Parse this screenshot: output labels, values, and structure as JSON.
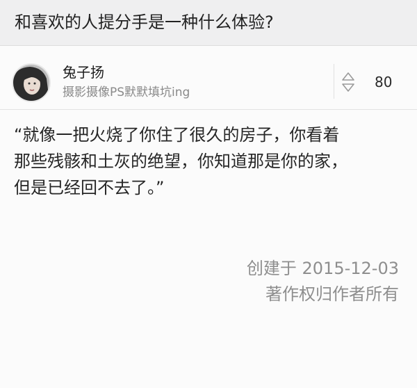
{
  "question": {
    "title": "和喜欢的人提分手是一种什么体验?"
  },
  "author": {
    "name": "兔子扬",
    "bio": "摄影摄像PS默默填坑ing",
    "avatar_icon": "user-avatar"
  },
  "vote": {
    "icon": "vote-arrows-icon",
    "count": "80"
  },
  "answer": {
    "lines": [
      "“就像一把火烧了你住了很久的房子，你看着",
      "那些残骸和土灰的绝望，你知道那是你的家，",
      "但是已经回不去了。”"
    ]
  },
  "meta": {
    "created": "创建于 2015-12-03",
    "copyright": "著作权归作者所有"
  },
  "colors": {
    "question_bg": "#efeff0",
    "page_bg": "#fbfbfb",
    "muted_text": "#8e8e8e"
  }
}
